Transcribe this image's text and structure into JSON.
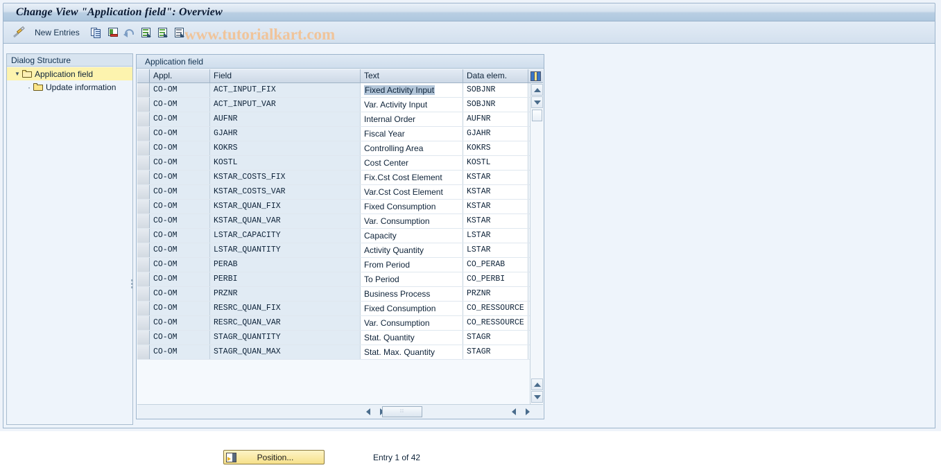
{
  "window": {
    "title": "Change View \"Application field\": Overview"
  },
  "toolbar": {
    "change_icon": "pencil-icon",
    "new_entries_label": "New Entries",
    "icons": [
      {
        "name": "copy-as-icon"
      },
      {
        "name": "delete-icon"
      },
      {
        "name": "undo-icon"
      },
      {
        "name": "select-all-icon"
      },
      {
        "name": "deselect-all-icon"
      },
      {
        "name": "select-block-icon"
      }
    ],
    "watermark": "www.tutorialkart.com"
  },
  "sidebar": {
    "header": "Dialog Structure",
    "items": [
      {
        "label": "Application field",
        "selected": true,
        "level": 0,
        "expanded": true
      },
      {
        "label": "Update information",
        "selected": false,
        "level": 1,
        "expanded": false
      }
    ]
  },
  "table": {
    "caption": "Application field",
    "columns": [
      "Appl.",
      "Field",
      "Text",
      "Data elem."
    ],
    "config_icon": "table-settings-icon",
    "rows": [
      {
        "appl": "CO-OM",
        "field": "ACT_INPUT_FIX",
        "text": "Fixed Activity Input",
        "data_elem": "SOBJNR",
        "selected": true
      },
      {
        "appl": "CO-OM",
        "field": "ACT_INPUT_VAR",
        "text": "Var. Activity Input",
        "data_elem": "SOBJNR",
        "selected": false
      },
      {
        "appl": "CO-OM",
        "field": "AUFNR",
        "text": "Internal Order",
        "data_elem": "AUFNR",
        "selected": false
      },
      {
        "appl": "CO-OM",
        "field": "GJAHR",
        "text": "Fiscal Year",
        "data_elem": "GJAHR",
        "selected": false
      },
      {
        "appl": "CO-OM",
        "field": "KOKRS",
        "text": "Controlling Area",
        "data_elem": "KOKRS",
        "selected": false
      },
      {
        "appl": "CO-OM",
        "field": "KOSTL",
        "text": "Cost Center",
        "data_elem": "KOSTL",
        "selected": false
      },
      {
        "appl": "CO-OM",
        "field": "KSTAR_COSTS_FIX",
        "text": "Fix.Cst Cost Element",
        "data_elem": "KSTAR",
        "selected": false
      },
      {
        "appl": "CO-OM",
        "field": "KSTAR_COSTS_VAR",
        "text": "Var.Cst Cost Element",
        "data_elem": "KSTAR",
        "selected": false
      },
      {
        "appl": "CO-OM",
        "field": "KSTAR_QUAN_FIX",
        "text": "Fixed Consumption",
        "data_elem": "KSTAR",
        "selected": false
      },
      {
        "appl": "CO-OM",
        "field": "KSTAR_QUAN_VAR",
        "text": "Var. Consumption",
        "data_elem": "KSTAR",
        "selected": false
      },
      {
        "appl": "CO-OM",
        "field": "LSTAR_CAPACITY",
        "text": "Capacity",
        "data_elem": "LSTAR",
        "selected": false
      },
      {
        "appl": "CO-OM",
        "field": "LSTAR_QUANTITY",
        "text": "Activity Quantity",
        "data_elem": "LSTAR",
        "selected": false
      },
      {
        "appl": "CO-OM",
        "field": "PERAB",
        "text": "From Period",
        "data_elem": "CO_PERAB",
        "selected": false
      },
      {
        "appl": "CO-OM",
        "field": "PERBI",
        "text": "To Period",
        "data_elem": "CO_PERBI",
        "selected": false
      },
      {
        "appl": "CO-OM",
        "field": "PRZNR",
        "text": "Business Process",
        "data_elem": "PRZNR",
        "selected": false
      },
      {
        "appl": "CO-OM",
        "field": "RESRC_QUAN_FIX",
        "text": "Fixed Consumption",
        "data_elem": "CO_RESSOURCE",
        "selected": false
      },
      {
        "appl": "CO-OM",
        "field": "RESRC_QUAN_VAR",
        "text": "Var. Consumption",
        "data_elem": "CO_RESSOURCE",
        "selected": false
      },
      {
        "appl": "CO-OM",
        "field": "STAGR_QUANTITY",
        "text": "Stat. Quantity",
        "data_elem": "STAGR",
        "selected": false
      },
      {
        "appl": "CO-OM",
        "field": "STAGR_QUAN_MAX",
        "text": "Stat. Max. Quantity",
        "data_elem": "STAGR",
        "selected": false
      }
    ]
  },
  "footer": {
    "position_button": "Position...",
    "entry_status": "Entry 1 of 42"
  },
  "colors": {
    "title_bar": "#aec7de",
    "selected_tree_item": "#fdf3ae",
    "row_key_cell": "#e1ebf4",
    "selection_highlight": "#b3c6d9",
    "watermark": "#f0c49a",
    "position_button": "#f6e08a"
  }
}
